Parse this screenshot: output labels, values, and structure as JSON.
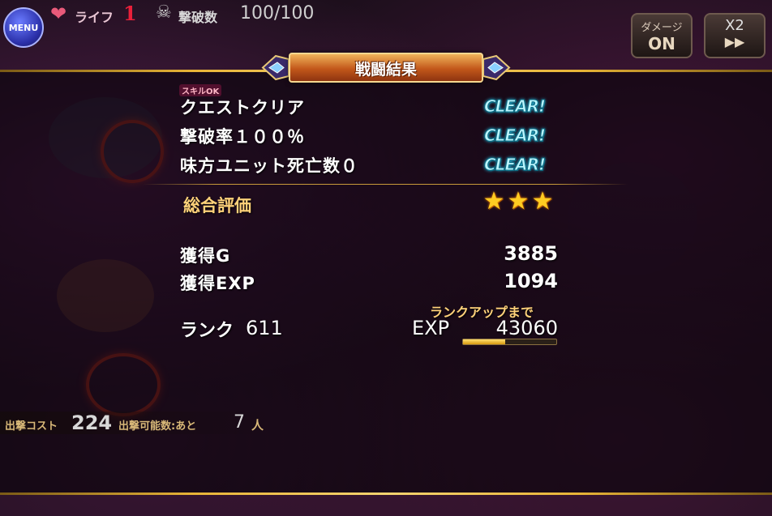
{
  "hud": {
    "menu_label": "MENU",
    "life_label": "ライフ",
    "life_value": "1",
    "kill_label": "撃破数",
    "kill_value": "100/100",
    "damage_button": {
      "line1": "ダメージ",
      "line2": "ON"
    },
    "speed_button": {
      "line1": "X2",
      "line2": "▶▶"
    },
    "icons": [
      "heart-icon",
      "skull-icon"
    ]
  },
  "result": {
    "title": "戦闘結果",
    "skill_tag": "スキルOK",
    "conditions": [
      {
        "label": "クエストクリア",
        "status": "CLEAR!"
      },
      {
        "label": "撃破率１００％",
        "status": "CLEAR!"
      },
      {
        "label": "味方ユニット死亡数０",
        "status": "CLEAR!"
      }
    ],
    "evaluation_label": "総合評価",
    "stars": 3,
    "star_glyph": "★",
    "gold_label": "獲得G",
    "gold_value": "3885",
    "exp_gain_label": "獲得EXP",
    "exp_gain_value": "1094",
    "rank_label": "ランク",
    "rank_value": "611",
    "rankup_caption": "ランクアップまで",
    "exp_label": "EXP",
    "exp_to_next": "43060",
    "exp_progress_fraction": 0.45
  },
  "bottom": {
    "cost_label": "出撃コスト",
    "cost_value": "224",
    "deploy_label": "出撃可能数:あと",
    "deploy_value": "7",
    "deploy_unit": "人"
  },
  "colors": {
    "gold_line": "#e8b437",
    "banner": "#c2571a",
    "clear_text": "#baf5ff",
    "star": "#ffcc22",
    "eval_label": "#ffd27a"
  }
}
